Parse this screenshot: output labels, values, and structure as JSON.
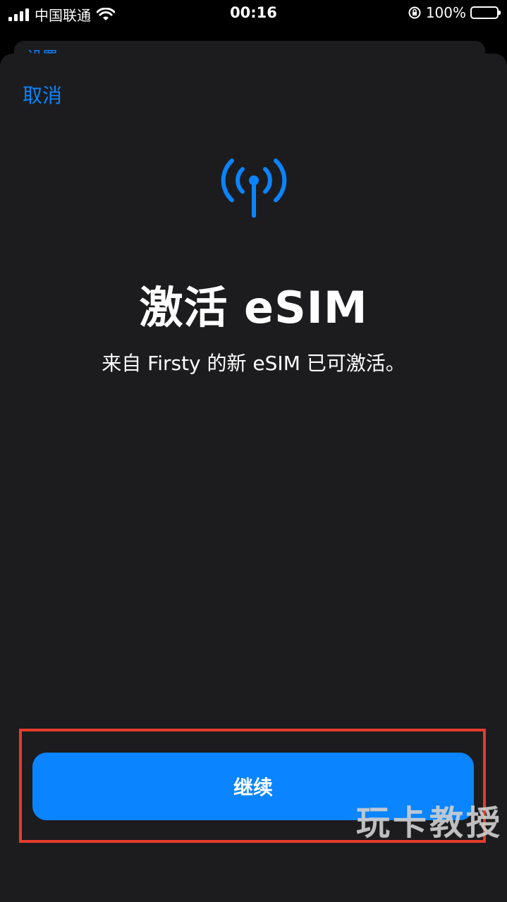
{
  "status_bar": {
    "carrier": "中国联通",
    "time": "00:16",
    "battery": "100%"
  },
  "background": {
    "title": "设置"
  },
  "sheet": {
    "cancel_label": "取消",
    "title": "激活 eSIM",
    "subtitle": "来自 Firsty 的新 eSIM 已可激活。",
    "continue_label": "继续",
    "icon": "antenna-signal-icon"
  },
  "watermark": "玩卡教授",
  "colors": {
    "accent": "#0a84ff",
    "sheet_bg": "#1c1c1e",
    "highlight": "#e53b2c"
  }
}
